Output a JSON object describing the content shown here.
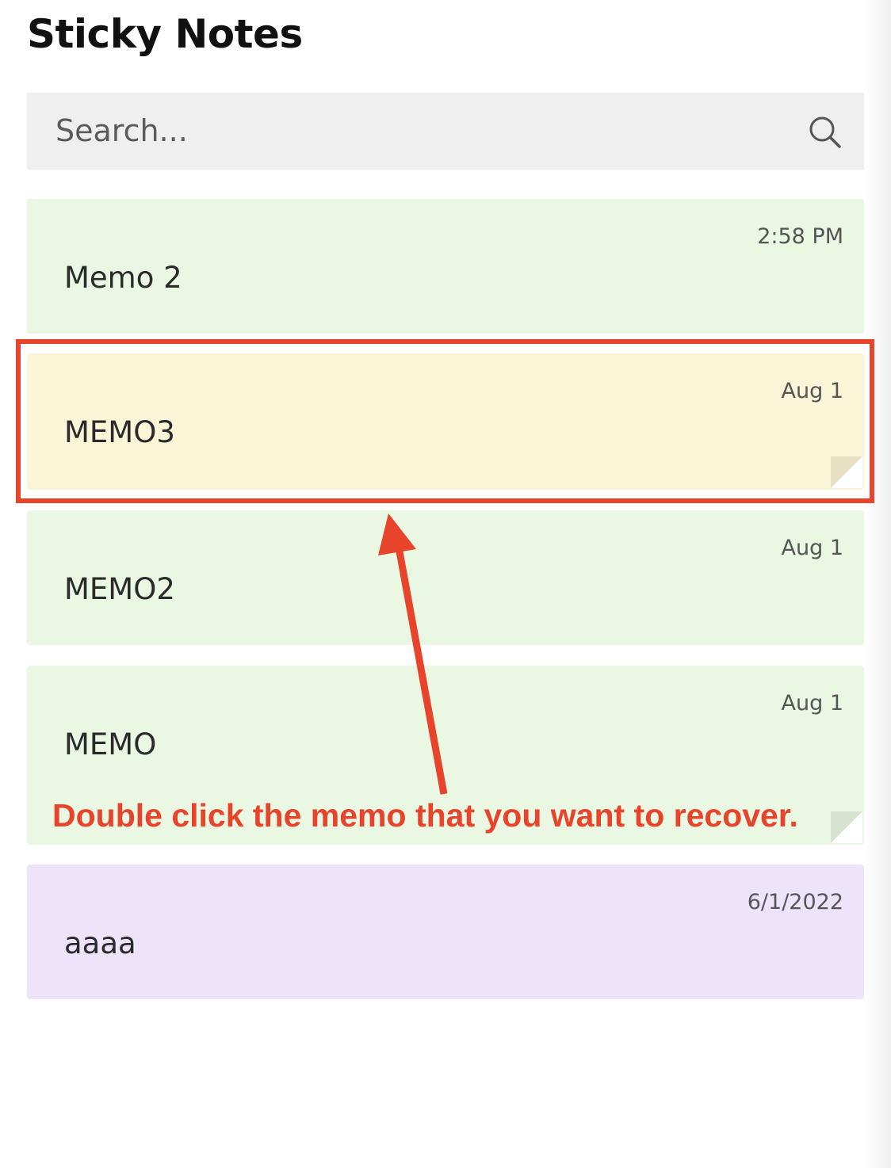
{
  "app": {
    "title": "Sticky Notes"
  },
  "search": {
    "placeholder": "Search..."
  },
  "notes": [
    {
      "label": "Memo 2",
      "time": "2:58 PM",
      "color": "#e9f7e3"
    },
    {
      "label": "MEMO3",
      "time": "Aug 1",
      "color": "#fbf5d7"
    },
    {
      "label": "MEMO2",
      "time": "Aug 1",
      "color": "#e9f7e3"
    },
    {
      "label": "MEMO",
      "time": "Aug 1",
      "color": "#e9f7e3"
    },
    {
      "label": "aaaa",
      "time": "6/1/2022",
      "color": "#ede4fb"
    }
  ],
  "annotation": {
    "text": "Double click the memo that you want to recover.",
    "color": "#e8432b"
  }
}
